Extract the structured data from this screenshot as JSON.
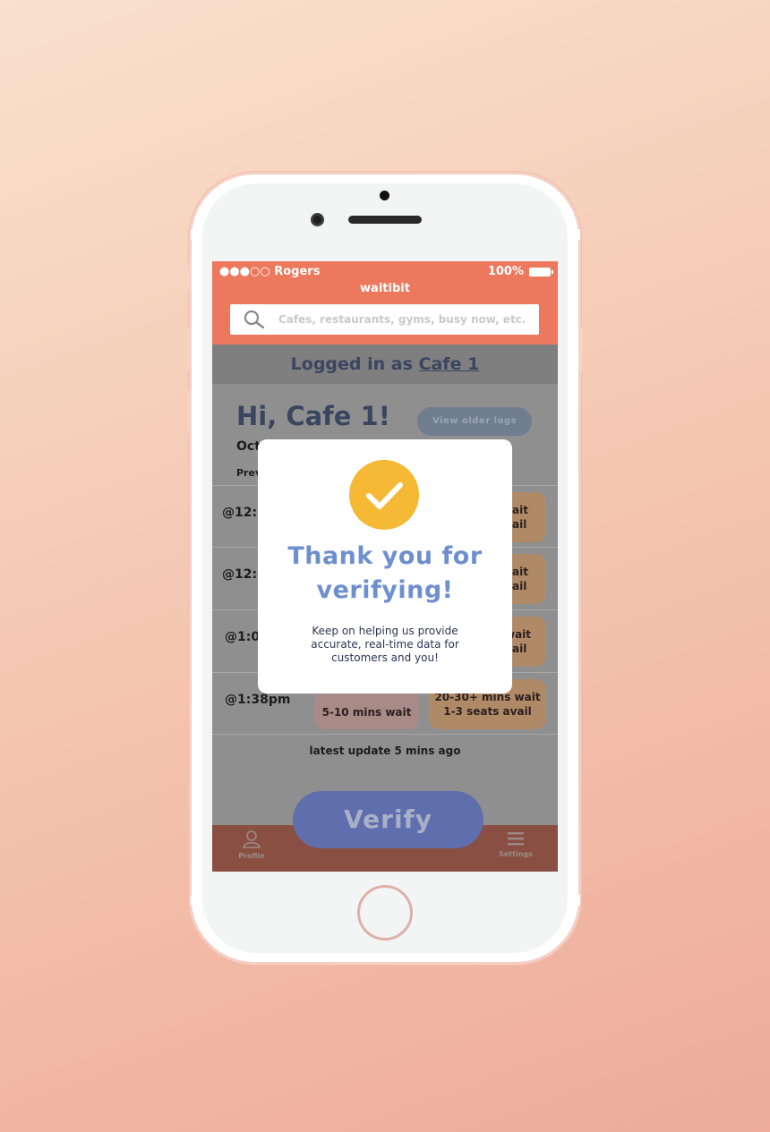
{
  "status_bar": {
    "carrier": "●●●○○ Rogers",
    "battery": "100%"
  },
  "header": {
    "app_title": "waitibit",
    "search_placeholder": "Cafes, restaurants, gyms, busy now, etc."
  },
  "session": {
    "logged_in_prefix": "Logged in as ",
    "cafe_name": "Cafe 1"
  },
  "dashboard": {
    "greeting": "Hi, Cafe 1!",
    "date_partial": "Oct",
    "prev_partial": "Prev",
    "older_logs_label": "View older logs",
    "latest_update": "latest update 5 mins ago"
  },
  "logs": [
    {
      "time": "@12:3",
      "right_line1": "ait",
      "right_line2": "ail"
    },
    {
      "time": "@12:4",
      "right_line1": "ait",
      "right_line2": "ail"
    },
    {
      "time": "@1:0",
      "right_line1": "wait",
      "right_line2": "ail"
    },
    {
      "time": "@1:38pm",
      "left_pill": "5-10 mins wait",
      "right_line1": "20-30+ mins wait",
      "right_line2": "1-3 seats avail"
    }
  ],
  "verify_label": "Verify",
  "nav": {
    "profile": "Profile",
    "settings": "Settings"
  },
  "modal": {
    "title_line1": "Thank you for",
    "title_line2": "verifying!",
    "body": "Keep on helping us provide accurate, real-time data for customers and you!"
  },
  "colors": {
    "brand_orange": "#ec785d",
    "check_yellow": "#f5b935",
    "title_blue": "#6e8fcd",
    "verify_blue": "#5f6fae"
  }
}
